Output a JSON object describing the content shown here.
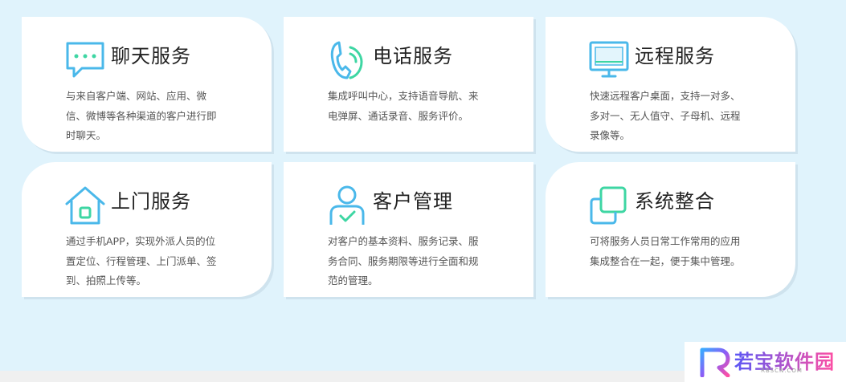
{
  "services": [
    {
      "icon": "chat-bubble-icon",
      "title": "聊天服务",
      "desc": "与来自客户端、网站、应用、微信、微博等各种渠道的客户进行即时聊天。"
    },
    {
      "icon": "phone-icon",
      "title": "电话服务",
      "desc": "集成呼叫中心，支持语音导航、来电弹屏、通话录音、服务评价。"
    },
    {
      "icon": "monitor-icon",
      "title": "远程服务",
      "desc": "快速远程客户桌面，支持一对多、多对一、无人值守、子母机、远程录像等。"
    },
    {
      "icon": "home-icon",
      "title": "上门服务",
      "desc": "通过手机APP，实现外派人员的位置定位、行程管理、上门派单、签到、拍照上传等。"
    },
    {
      "icon": "user-check-icon",
      "title": "客户管理",
      "desc": "对客户的基本资料、服务记录、服务合同、服务期限等进行全面和规范的管理。"
    },
    {
      "icon": "integration-icon",
      "title": "系统整合",
      "desc": "可将服务人员日常工作常用的应用集成整合在一起，便于集中管理。"
    }
  ],
  "watermark": {
    "title": "若宝软件园",
    "subtitle": "RBSCN.COM"
  },
  "colors": {
    "icon_blue": "#4ab8ea",
    "icon_green": "#3ed6a3",
    "background": "#e0f3fc"
  }
}
